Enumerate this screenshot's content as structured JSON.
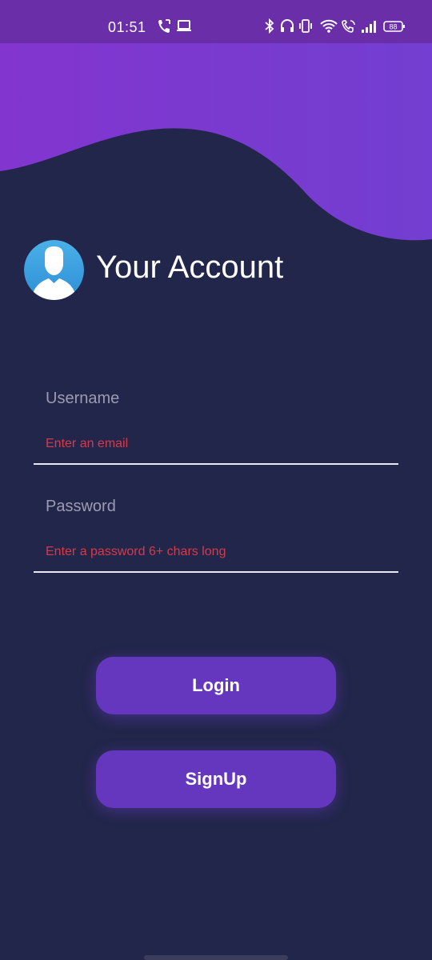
{
  "status_bar": {
    "time": "01:51",
    "battery": "88",
    "icons": [
      "call-icon",
      "laptop-icon",
      "bluetooth-icon",
      "headphones-icon",
      "vibrate-icon",
      "wifi-icon",
      "wifi-call-icon",
      "signal-icon",
      "battery-icon"
    ]
  },
  "header": {
    "title": "Your Account",
    "avatar_icon": "user-avatar-icon"
  },
  "form": {
    "username": {
      "label": "Username",
      "error": "Enter an email",
      "value": ""
    },
    "password": {
      "label": "Password",
      "error": "Enter a password 6+ chars long",
      "value": ""
    }
  },
  "buttons": {
    "login": "Login",
    "signup": "SignUp"
  },
  "colors": {
    "background": "#22264a",
    "wave_purple": "#7b3ad0",
    "button": "#6437be",
    "error": "#d63a4a"
  }
}
